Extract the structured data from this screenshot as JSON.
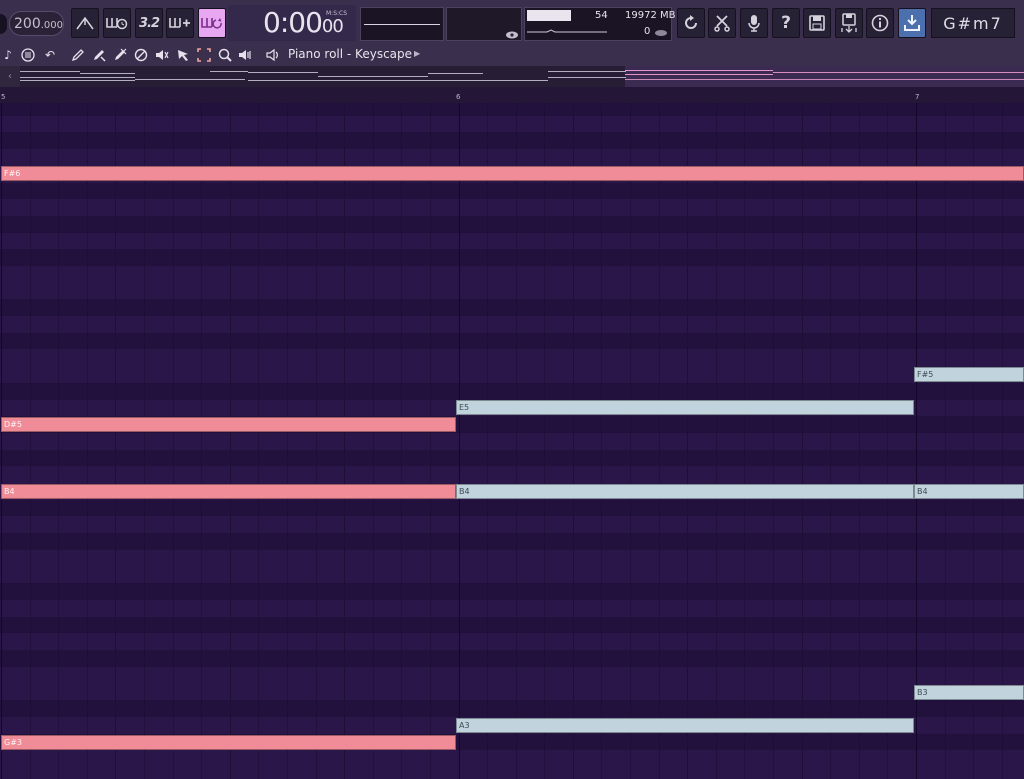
{
  "app": {
    "title": "Piano roll - Keyscape"
  },
  "toolbar": {
    "tempo_whole": "200",
    "tempo_decimal": ".000",
    "time_main": "0:00",
    "time_cs": "00",
    "time_format": "M:S:CS",
    "cpu_value": "54",
    "memory_value": "19972 MB",
    "polyphony_value": "0",
    "key_display": "G#m7",
    "mode_button_label": "3.2"
  },
  "piano_roll": {
    "title": "Piano roll - Keyscape",
    "bar_numbers": [
      "5",
      "6",
      "7"
    ]
  },
  "notes": [
    {
      "label": "F#6",
      "color": "pink"
    },
    {
      "label": "D#5",
      "color": "pink"
    },
    {
      "label": "B4",
      "color": "pink"
    },
    {
      "label": "G#3",
      "color": "pink"
    },
    {
      "label": "E5",
      "color": "gray"
    },
    {
      "label": "B4",
      "color": "gray"
    },
    {
      "label": "A3",
      "color": "gray"
    },
    {
      "label": "F#5",
      "color": "gray"
    },
    {
      "label": "B4",
      "color": "gray"
    },
    {
      "label": "B3",
      "color": "gray"
    }
  ],
  "colors": {
    "note_pink": "#ef8c98",
    "note_gray": "#c1d4de",
    "background": "#2a1649",
    "toolbar": "#3a2f4c",
    "active_button": "#e8a7f1"
  }
}
